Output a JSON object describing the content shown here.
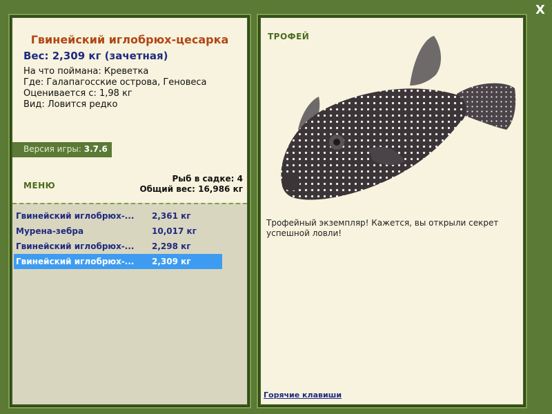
{
  "fish": {
    "title": "Гвинейский иглобрюх-цесарка",
    "weight": "Вес: 2,309 кг (зачетная)",
    "caught_on": "На что поймана: Креветка",
    "where": "Где: Галапагосские острова, Геновеса",
    "rated_from": "Оценивается с: 1,98 кг",
    "kind": "Вид: Ловится редко"
  },
  "version": {
    "label": "Версия игры:",
    "value": "3.7.6"
  },
  "menu_label": "МЕНЮ",
  "stats": {
    "count": "Рыб в садке: 4",
    "total": "Общий вес: 16,986 кг"
  },
  "catch_list": [
    {
      "name": "Гвинейский иглобрюх-...",
      "weight": "2,361 кг",
      "selected": false
    },
    {
      "name": "Мурена-зебра",
      "weight": "10,017 кг",
      "selected": false
    },
    {
      "name": "Гвинейский иглобрюх-...",
      "weight": "2,298 кг",
      "selected": false
    },
    {
      "name": "Гвинейский иглобрюх-...",
      "weight": "2,309 кг",
      "selected": true
    }
  ],
  "trophy": {
    "label": "ТРОФЕЙ",
    "text": "Трофейный экземпляр! Кажется, вы открыли секрет успешной ловли!"
  },
  "hotkeys_label": "Горячие клавиши",
  "close_label": "X"
}
